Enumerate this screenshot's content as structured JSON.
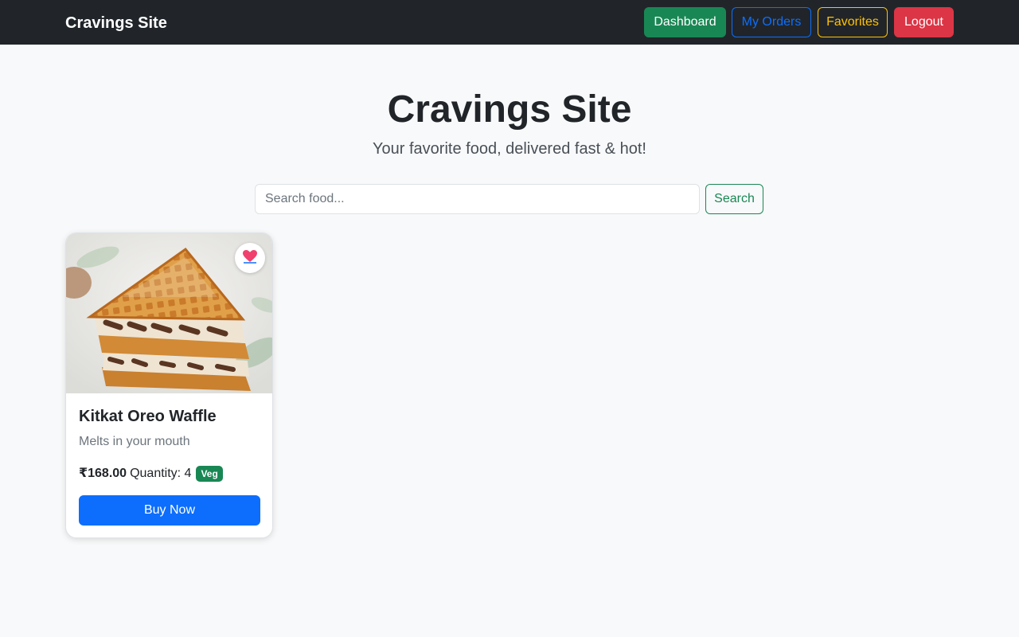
{
  "navbar": {
    "brand": "Cravings Site",
    "dashboard_label": "Dashboard",
    "orders_label": "My Orders",
    "favorites_label": "Favorites",
    "logout_label": "Logout"
  },
  "hero": {
    "title": "Cravings Site",
    "subtitle": "Your favorite food, delivered fast & hot!"
  },
  "search": {
    "placeholder": "Search food...",
    "value": "",
    "button_label": "Search"
  },
  "products": [
    {
      "name": "Kitkat Oreo Waffle",
      "description": "Melts in your mouth",
      "price": "₹168.00",
      "quantity_label": "Quantity: 4",
      "badge": "Veg",
      "buy_label": "Buy Now",
      "image": "waffle-sandwich-photo",
      "favorite_icon": "heart-icon"
    }
  ],
  "colors": {
    "navbar_bg": "#212529",
    "success": "#198754",
    "primary": "#0d6efd",
    "warning": "#ffc107",
    "danger": "#dc3545",
    "page_bg": "#f8f9fa"
  }
}
